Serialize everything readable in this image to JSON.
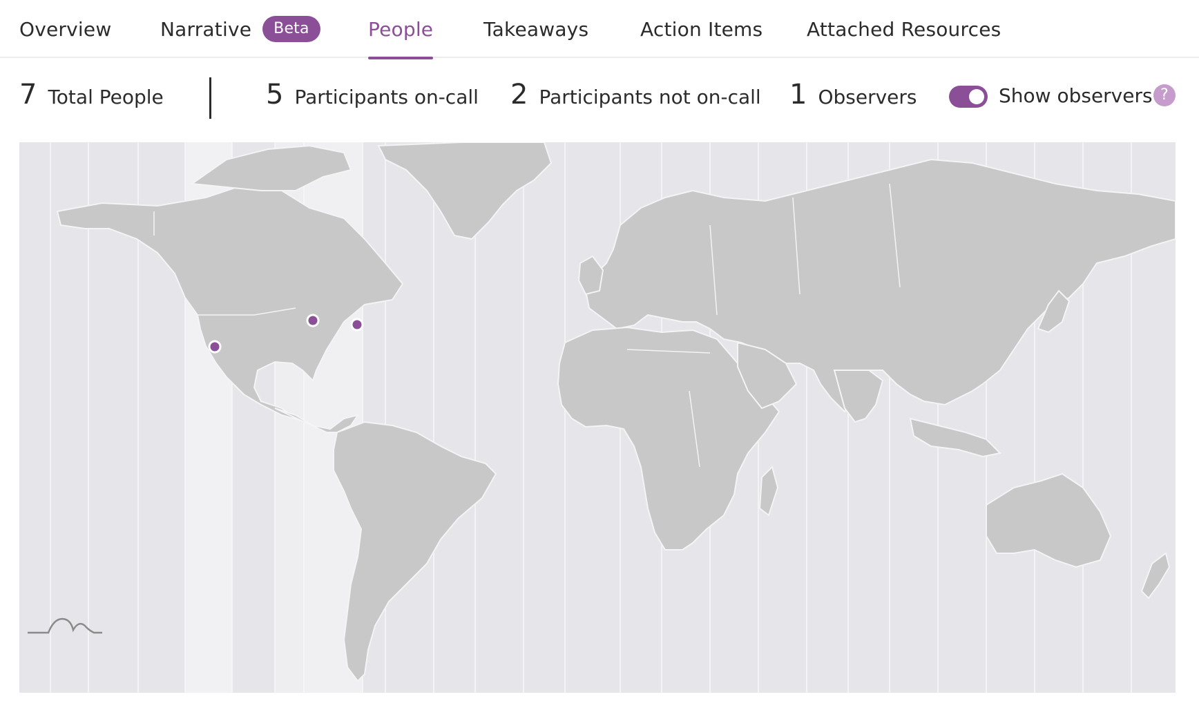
{
  "tabs": [
    {
      "label": "Overview"
    },
    {
      "label": "Narrative",
      "badge": "Beta"
    },
    {
      "label": "People",
      "active": true
    },
    {
      "label": "Takeaways"
    },
    {
      "label": "Action Items"
    },
    {
      "label": "Attached Resources"
    }
  ],
  "stats": {
    "total": {
      "value": "7",
      "label": "Total People"
    },
    "on_call": {
      "value": "5",
      "label": "Participants on-call"
    },
    "not_on_call": {
      "value": "2",
      "label": "Participants not on-call"
    },
    "observers": {
      "value": "1",
      "label": "Observers"
    }
  },
  "toggle": {
    "label": "Show observers",
    "on": true
  },
  "help": {
    "glyph": "?"
  },
  "colors": {
    "accent": "#8b4f97",
    "badge_bg": "#8b4f97",
    "land": "#c8c8c8",
    "ocean": "#e6e6ea",
    "help_bg": "#c69ccd"
  },
  "map": {
    "markers": [
      {
        "name": "los-angeles-marker"
      },
      {
        "name": "chicago-marker"
      },
      {
        "name": "new-york-marker"
      }
    ],
    "logo_icon": "mountain-logo-icon"
  }
}
